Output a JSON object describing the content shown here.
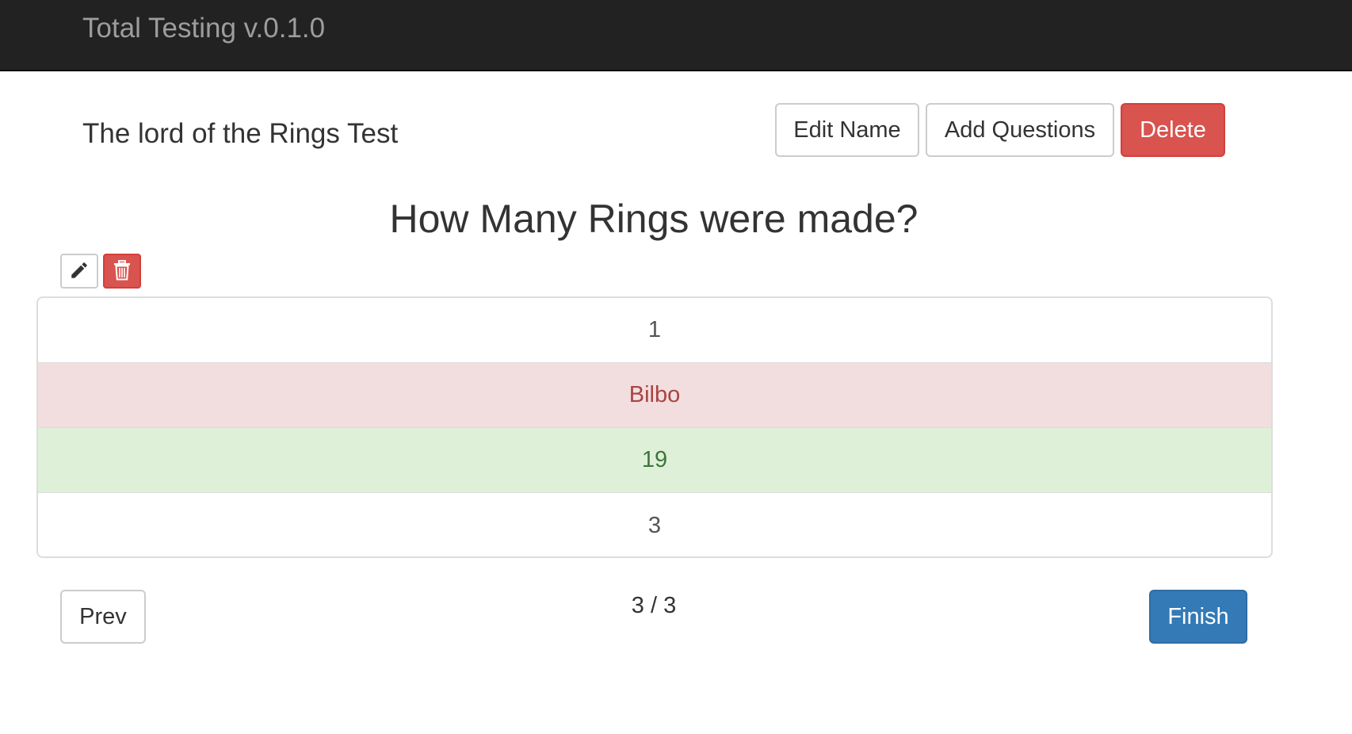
{
  "navbar": {
    "brand": "Total Testing v.0.1.0"
  },
  "test": {
    "title": "The lord of the Rings Test",
    "actions": {
      "edit_name": "Edit Name",
      "add_questions": "Add Questions",
      "delete": "Delete"
    }
  },
  "question": {
    "text": "How Many Rings were made?",
    "answers": [
      {
        "label": "1",
        "state": "neutral"
      },
      {
        "label": "Bilbo",
        "state": "wrong"
      },
      {
        "label": "19",
        "state": "correct"
      },
      {
        "label": "3",
        "state": "neutral"
      }
    ]
  },
  "icons": {
    "edit": "pencil-icon",
    "delete": "trash-icon"
  },
  "pagination": {
    "prev_label": "Prev",
    "counter": "3 / 3",
    "finish_label": "Finish"
  },
  "colors": {
    "navbar_bg": "#222222",
    "danger": "#d9534f",
    "primary": "#337ab7",
    "wrong_bg": "#f2dede",
    "correct_bg": "#dff0d8"
  }
}
